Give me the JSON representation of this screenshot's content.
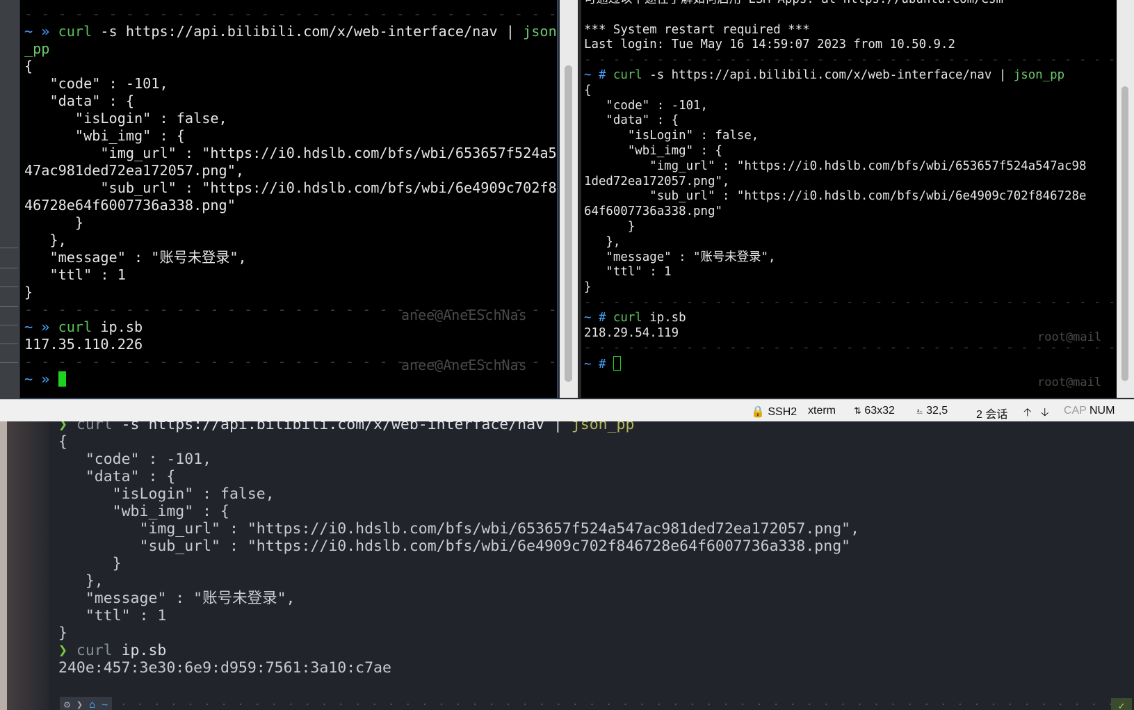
{
  "left_terminal": {
    "lines": [
      {
        "t": "- - - - - - - - - - - - - - - - - - - - - - - - - - - - - - - - - - - - - - - -",
        "k": "dash"
      },
      {
        "t": "~ » curl -s https://api.bilibili.com/x/web-interface/nav | json",
        "k": "cmdline"
      },
      {
        "t": "_pp",
        "k": "hl"
      },
      {
        "t": "{",
        "k": "out"
      },
      {
        "t": "   \"code\" : -101,",
        "k": "out"
      },
      {
        "t": "   \"data\" : {",
        "k": "out"
      },
      {
        "t": "      \"isLogin\" : false,",
        "k": "out"
      },
      {
        "t": "      \"wbi_img\" : {",
        "k": "out"
      },
      {
        "t": "         \"img_url\" : \"https://i0.hdslb.com/bfs/wbi/653657f524a5",
        "k": "out"
      },
      {
        "t": "47ac981ded72ea172057.png\",",
        "k": "out"
      },
      {
        "t": "         \"sub_url\" : \"https://i0.hdslb.com/bfs/wbi/6e4909c702f8",
        "k": "out"
      },
      {
        "t": "46728e64f6007736a338.png\"",
        "k": "out"
      },
      {
        "t": "      }",
        "k": "out"
      },
      {
        "t": "   },",
        "k": "out"
      },
      {
        "t": "   \"message\" : \"账号未登录\",",
        "k": "out"
      },
      {
        "t": "   \"ttl\" : 1",
        "k": "out"
      },
      {
        "t": "}",
        "k": "out"
      },
      {
        "t": "- - - - - - - - - - - - - - - - - - - - - - - - - - - - - - - - - - - - - - - -",
        "k": "dash"
      },
      {
        "t": "~ » curl ip.sb",
        "k": "cmdline2"
      },
      {
        "t": "117.35.110.226",
        "k": "out"
      },
      {
        "t": "- - - - - - - - - - - - - - - - - - - - - - - - - - - - - - - - - - - - - - - -",
        "k": "dash"
      },
      {
        "t": "~ » ",
        "k": "cursorline"
      }
    ],
    "right_prompt": "anee@AneESchNas"
  },
  "right_terminal": {
    "lines": [
      {
        "t": "可通过以下途径了解如何启用 ESM Apps: at https://ubuntu.com/esm",
        "k": "out"
      },
      {
        "t": "",
        "k": "out"
      },
      {
        "t": "*** System restart required ***",
        "k": "out"
      },
      {
        "t": "Last login: Tue May 16 14:59:07 2023 from 10.50.9.2",
        "k": "out"
      },
      {
        "t": "- - - - - - - - - - - - - - - - - - - - - - - - - - - - - - - - - - - - - - - - - - - - - - - -",
        "k": "dash"
      },
      {
        "t": "~ # curl -s https://api.bilibili.com/x/web-interface/nav | json_pp",
        "k": "cmdline"
      },
      {
        "t": "{",
        "k": "out"
      },
      {
        "t": "   \"code\" : -101,",
        "k": "out"
      },
      {
        "t": "   \"data\" : {",
        "k": "out"
      },
      {
        "t": "      \"isLogin\" : false,",
        "k": "out"
      },
      {
        "t": "      \"wbi_img\" : {",
        "k": "out"
      },
      {
        "t": "         \"img_url\" : \"https://i0.hdslb.com/bfs/wbi/653657f524a547ac98",
        "k": "out"
      },
      {
        "t": "1ded72ea172057.png\",",
        "k": "out"
      },
      {
        "t": "         \"sub_url\" : \"https://i0.hdslb.com/bfs/wbi/6e4909c702f846728e",
        "k": "out"
      },
      {
        "t": "64f6007736a338.png\"",
        "k": "out"
      },
      {
        "t": "      }",
        "k": "out"
      },
      {
        "t": "   },",
        "k": "out"
      },
      {
        "t": "   \"message\" : \"账号未登录\",",
        "k": "out"
      },
      {
        "t": "   \"ttl\" : 1",
        "k": "out"
      },
      {
        "t": "}",
        "k": "out"
      },
      {
        "t": "- - - - - - - - - - - - - - - - - - - - - - - - - - - - - - - - - - - - - - - - - - - - - - - -",
        "k": "dash"
      },
      {
        "t": "~ # curl ip.sb",
        "k": "cmdline2"
      },
      {
        "t": "218.29.54.119",
        "k": "out"
      },
      {
        "t": "- - - - - - - - - - - - - - - - - - - - - - - - - - - - - - - - - - - - - - - - - - - - - - - -",
        "k": "dash"
      },
      {
        "t": "~ # ",
        "k": "cursorline"
      }
    ],
    "right_prompt": "root@mail"
  },
  "statusbar": {
    "protocol": "SSH2",
    "terminal_type": "xterm",
    "size": "63x32",
    "cursor_pos": "32,5",
    "sessions": "2 会话",
    "caps": "CAP",
    "num": "NUM"
  },
  "bottom_terminal": {
    "lines": [
      {
        "t": "❯ curl -s https://api.bilibili.com/x/web-interface/nav | json_pp",
        "k": "cmdline"
      },
      {
        "t": "{",
        "k": "out"
      },
      {
        "t": "   \"code\" : -101,",
        "k": "out"
      },
      {
        "t": "   \"data\" : {",
        "k": "out"
      },
      {
        "t": "      \"isLogin\" : false,",
        "k": "out"
      },
      {
        "t": "      \"wbi_img\" : {",
        "k": "out"
      },
      {
        "t": "         \"img_url\" : \"https://i0.hdslb.com/bfs/wbi/653657f524a547ac981ded72ea172057.png\",",
        "k": "out"
      },
      {
        "t": "         \"sub_url\" : \"https://i0.hdslb.com/bfs/wbi/6e4909c702f846728e64f6007736a338.png\"",
        "k": "out"
      },
      {
        "t": "      }",
        "k": "out"
      },
      {
        "t": "   },",
        "k": "out"
      },
      {
        "t": "   \"message\" : \"账号未登录\",",
        "k": "out"
      },
      {
        "t": "   \"ttl\" : 1",
        "k": "out"
      },
      {
        "t": "}",
        "k": "out"
      },
      {
        "t": "❯ curl ip.sb",
        "k": "cmdline2"
      },
      {
        "t": "240e:457:3e30:6e9:d959:7561:3a10:c7ae",
        "k": "out"
      }
    ],
    "prompt_home": "~"
  },
  "colors": {
    "prompt_blue": "#4aa3ff",
    "command_green": "#5ac25a",
    "cursor_green": "#1ed31e",
    "bottom_bg": "#21252b"
  }
}
